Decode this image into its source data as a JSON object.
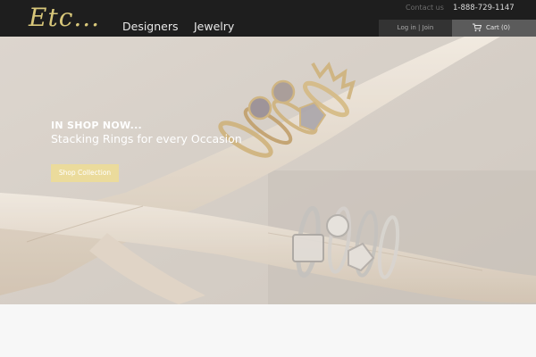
{
  "brand": {
    "logo_text": "Etc..."
  },
  "nav": {
    "designers": "Designers",
    "jewelry": "Jewelry"
  },
  "utility": {
    "contact": "Contact us",
    "phone": "1-888-729-1147",
    "login": "Log in | Join",
    "cart": "Cart (0)"
  },
  "hero": {
    "title": "IN SHOP NOW...",
    "subtitle": "Stacking Rings for every Occasion",
    "button": "Shop Collection"
  },
  "icons": {
    "cart": "cart-icon"
  },
  "colors": {
    "topbar": "#1e1e1e",
    "brand_gold": "#d8c77a",
    "button_gold": "#ebdb9c",
    "login_bg": "#333333",
    "cart_bg": "#5b5b5b"
  }
}
